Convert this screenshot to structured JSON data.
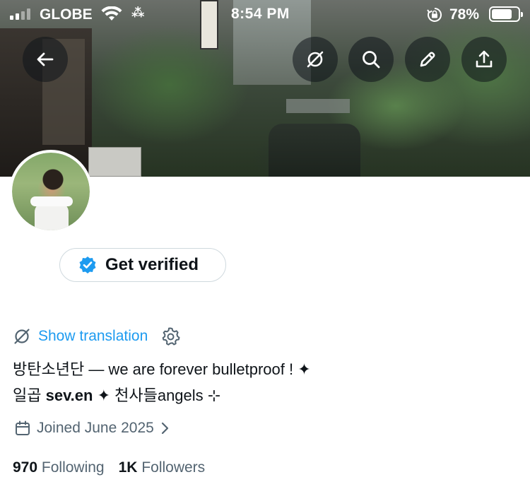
{
  "status_bar": {
    "carrier": "GLOBE",
    "time": "8:54 PM",
    "battery": "78%",
    "battery_level": 0.78,
    "signal_bars": 2
  },
  "banner": {
    "back_icon": "arrow-left-icon",
    "actions": [
      "translate-off-icon",
      "search-icon",
      "edit-icon",
      "share-icon"
    ]
  },
  "profile": {
    "get_verified_label": "Get verified",
    "translation_label": "Show translation",
    "bio_line1": "방탄소년단 — we are forever bulletproof ! ✦",
    "bio_line2_prefix": "일곱 ",
    "bio_line2_bold": "sev.en",
    "bio_line2_suffix": " ✦ 천사들angels ⊹",
    "joined": "Joined June 2025",
    "following_count": "970",
    "following_label": "Following",
    "followers_count": "1K",
    "followers_label": "Followers"
  },
  "colors": {
    "accent": "#1d9bf0",
    "text": "#0f1419",
    "muted": "#536471",
    "border": "#cfd9de"
  }
}
